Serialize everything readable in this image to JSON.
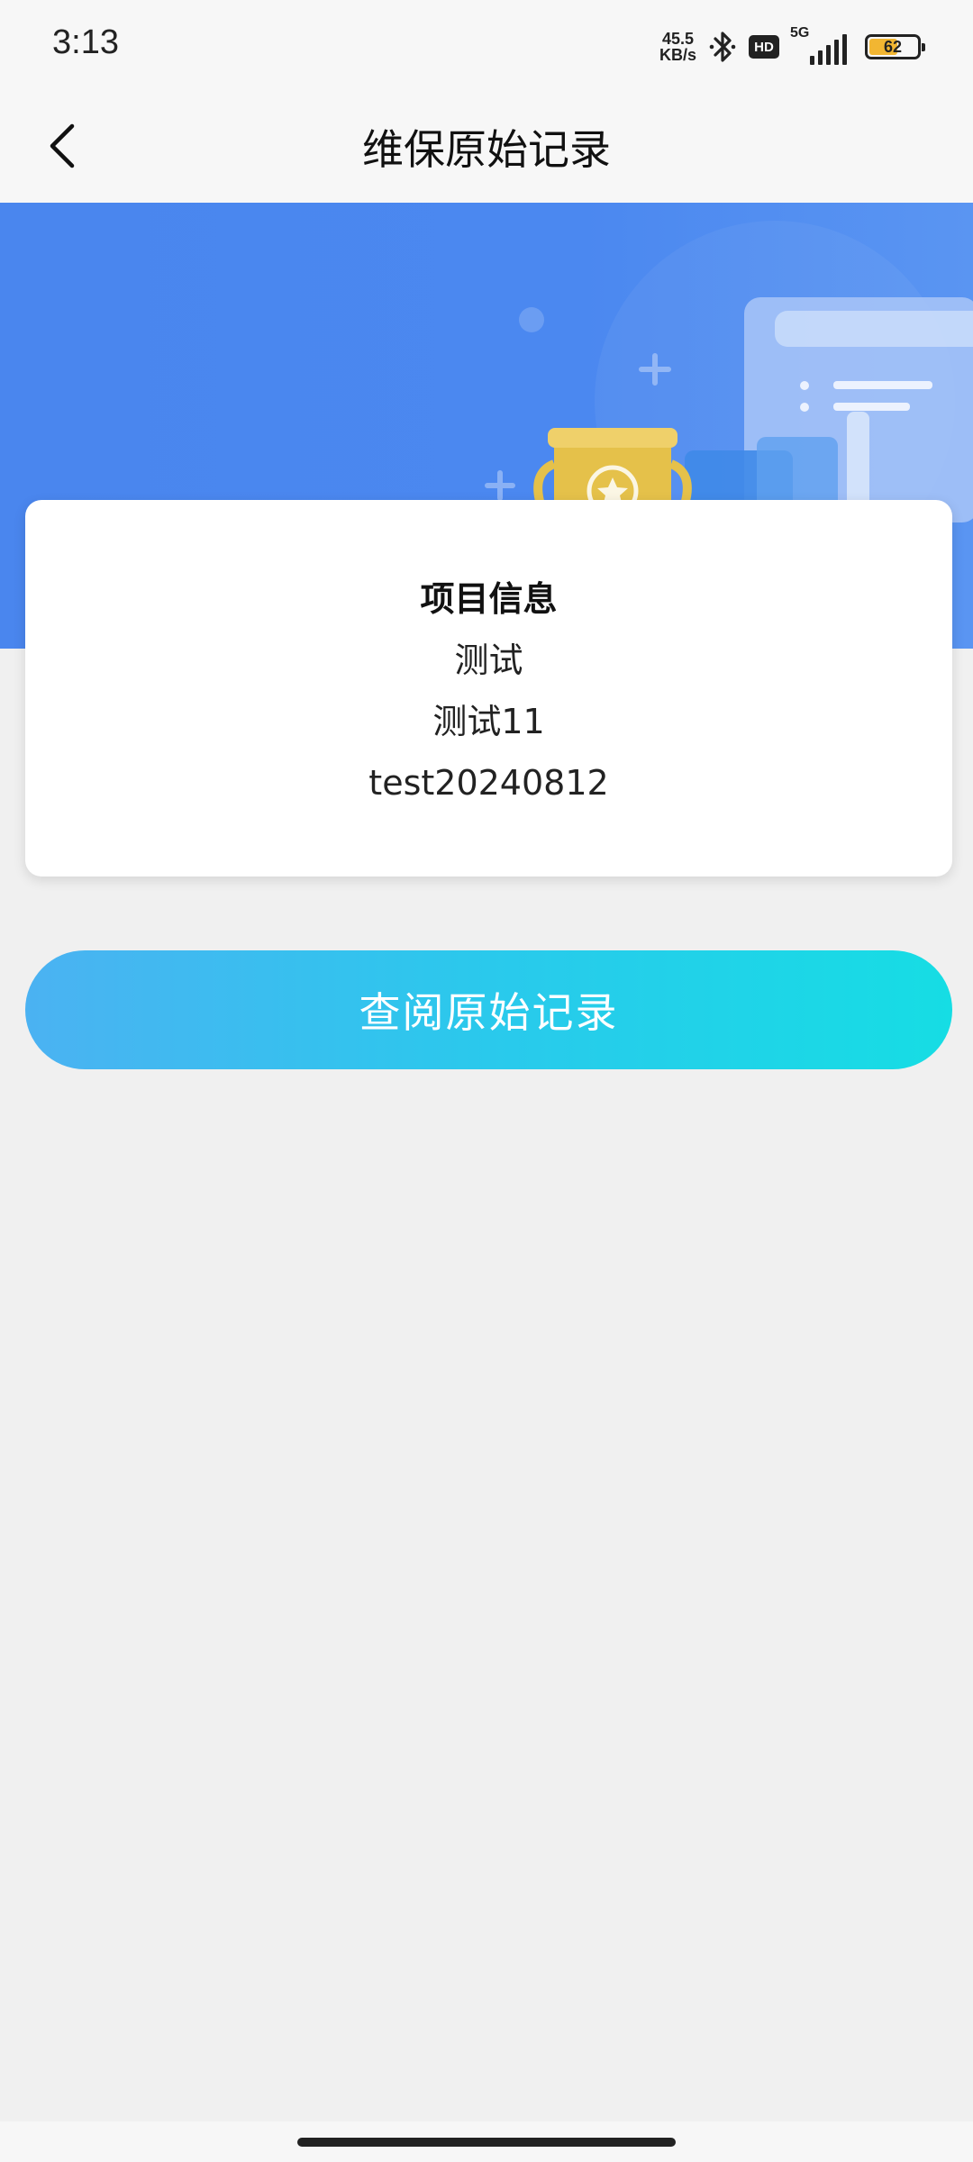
{
  "status_bar": {
    "time": "3:13",
    "net_speed_value": "45.5",
    "net_speed_unit": "KB/s",
    "bluetooth_icon": "bluetooth-icon",
    "hd_label": "HD",
    "network_type": "5G",
    "signal_icon": "cellular-signal-icon",
    "battery_level": "62",
    "battery_fill_fraction": 0.62,
    "battery_color": "#f2b632"
  },
  "nav": {
    "back_icon": "chevron-left-icon",
    "title": "维保原始记录"
  },
  "banner": {
    "color": "#4a86ee",
    "illustration": "trophy-and-document-illustration"
  },
  "project_card": {
    "title": "项目信息",
    "lines": [
      "测试",
      "测试11",
      "test20240812"
    ]
  },
  "actions": {
    "view_record_label": "查阅原始记录",
    "gradient_start": "#4bb2f2",
    "gradient_end": "#16dde4"
  }
}
